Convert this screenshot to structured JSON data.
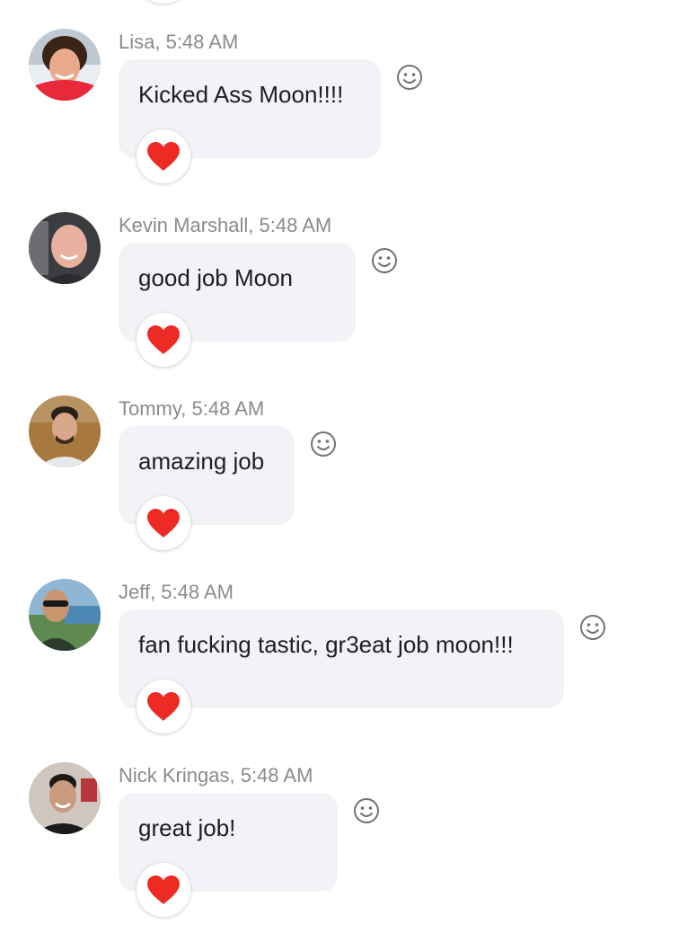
{
  "colors": {
    "bubble": "#f1f3f6",
    "meta_text": "#888b8f",
    "message_text": "#1c1e21",
    "heart": "#ee2a24",
    "smiley": "#6f7276"
  },
  "messages": [
    {
      "author": "Lisa",
      "time": "5:48 AM",
      "meta": "Lisa, 5:48 AM",
      "text": "Kicked Ass Moon!!!!",
      "reaction_icon": "heart-icon",
      "avatar_icon": "avatar-lisa"
    },
    {
      "author": "Kevin Marshall",
      "time": "5:48 AM",
      "meta": "Kevin Marshall, 5:48 AM",
      "text": "good job Moon",
      "reaction_icon": "heart-icon",
      "avatar_icon": "avatar-kevin"
    },
    {
      "author": "Tommy",
      "time": "5:48 AM",
      "meta": "Tommy, 5:48 AM",
      "text": "amazing job",
      "reaction_icon": "heart-icon",
      "avatar_icon": "avatar-tommy"
    },
    {
      "author": "Jeff",
      "time": "5:48 AM",
      "meta": "Jeff, 5:48 AM",
      "text": "fan fucking tastic, gr3eat job moon!!!",
      "reaction_icon": "heart-icon",
      "avatar_icon": "avatar-jeff"
    },
    {
      "author": "Nick Kringas",
      "time": "5:48 AM",
      "meta": "Nick Kringas, 5:48 AM",
      "text": "great job!",
      "reaction_icon": "heart-icon",
      "avatar_icon": "avatar-nick"
    }
  ]
}
